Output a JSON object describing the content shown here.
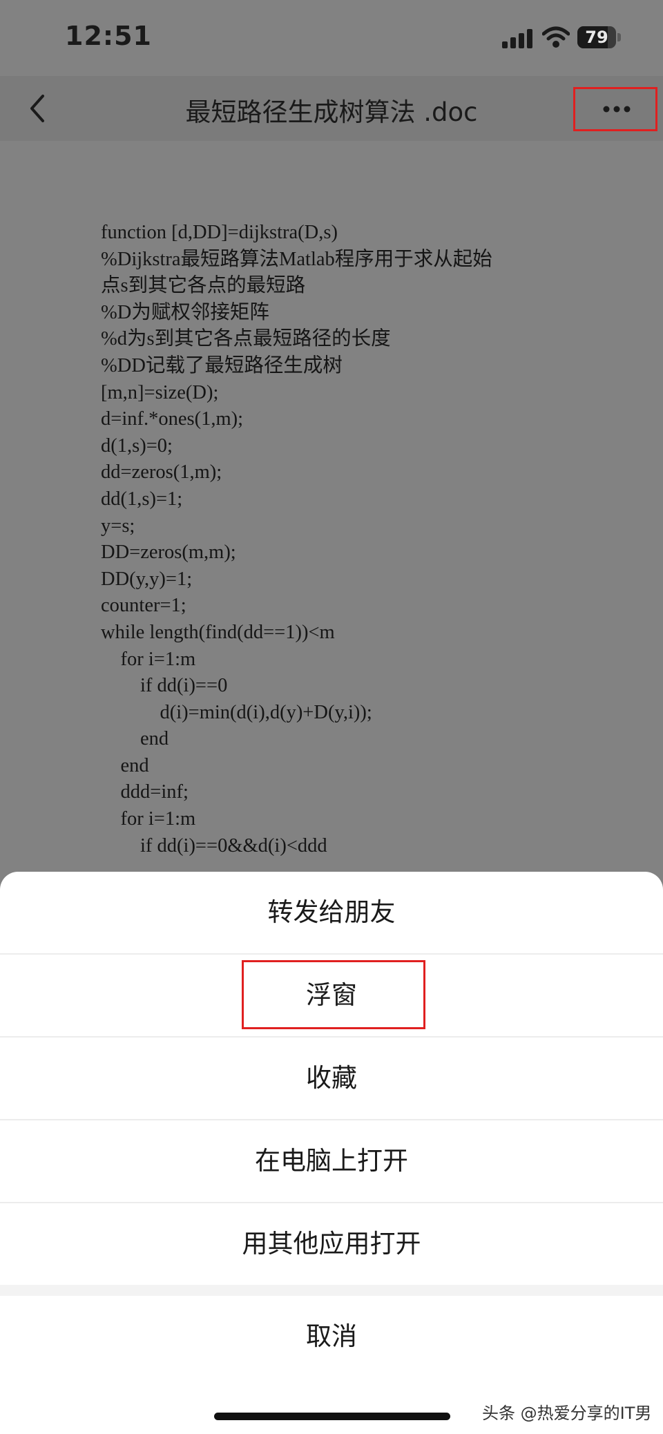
{
  "status_bar": {
    "time": "12:51",
    "battery_percent": "79",
    "battery_level": 0.79,
    "icons": [
      "signal-icon",
      "wifi-icon",
      "battery-icon"
    ]
  },
  "nav": {
    "title": "最短路径生成树算法 .doc",
    "back_icon": "chevron-left-icon",
    "more_icon": "ellipsis-icon",
    "highlight_color": "#e02020"
  },
  "document": {
    "lines": [
      "function [d,DD]=dijkstra(D,s)",
      "%Dijkstra最短路算法Matlab程序用于求从起始",
      "点s到其它各点的最短路",
      "%D为赋权邻接矩阵",
      "%d为s到其它各点最短路径的长度",
      "%DD记载了最短路径生成树",
      "[m,n]=size(D);",
      "d=inf.*ones(1,m);",
      "d(1,s)=0;",
      "dd=zeros(1,m);",
      "dd(1,s)=1;",
      "y=s;",
      "DD=zeros(m,m);",
      "DD(y,y)=1;",
      "counter=1;",
      "while length(find(dd==1))<m",
      "    for i=1:m",
      "        if dd(i)==0",
      "            d(i)=min(d(i),d(y)+D(y,i));",
      "        end",
      "    end",
      "    ddd=inf;",
      "    for i=1:m",
      "        if dd(i)==0&&d(i)<ddd"
    ]
  },
  "action_sheet": {
    "items": [
      "转发给朋友",
      "浮窗",
      "收藏",
      "在电脑上打开",
      "用其他应用打开"
    ],
    "cancel": "取消"
  },
  "watermark": "头条 @热爱分享的IT男"
}
